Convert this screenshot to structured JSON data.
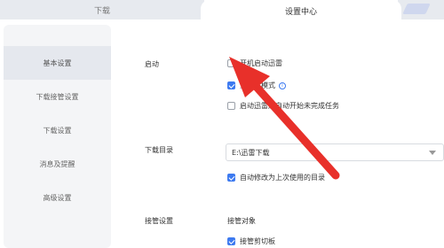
{
  "tabs": {
    "download": "下载",
    "settings": "设置中心"
  },
  "sidebar": {
    "items": [
      {
        "label": "基本设置"
      },
      {
        "label": "下载接管设置"
      },
      {
        "label": "下载设置"
      },
      {
        "label": "消息及提醒"
      },
      {
        "label": "高级设置"
      }
    ]
  },
  "startup": {
    "section_label": "启动",
    "autostart_label": "开机启动迅雷",
    "nodisturb_label": "免打扰模式",
    "resume_label": "启动迅雷后自动开始未完成任务"
  },
  "download_dir": {
    "section_label": "下载目录",
    "path": "E:\\迅雷下载",
    "auto_change_label": "自动修改为上次使用的目录"
  },
  "takeover": {
    "section_label": "接管设置",
    "target_label": "接管对象",
    "clipboard_label": "接管剪切板"
  },
  "colors": {
    "accent": "#3d7af0",
    "arrow": "#e8302a"
  },
  "icons": {
    "info": "info-icon"
  }
}
